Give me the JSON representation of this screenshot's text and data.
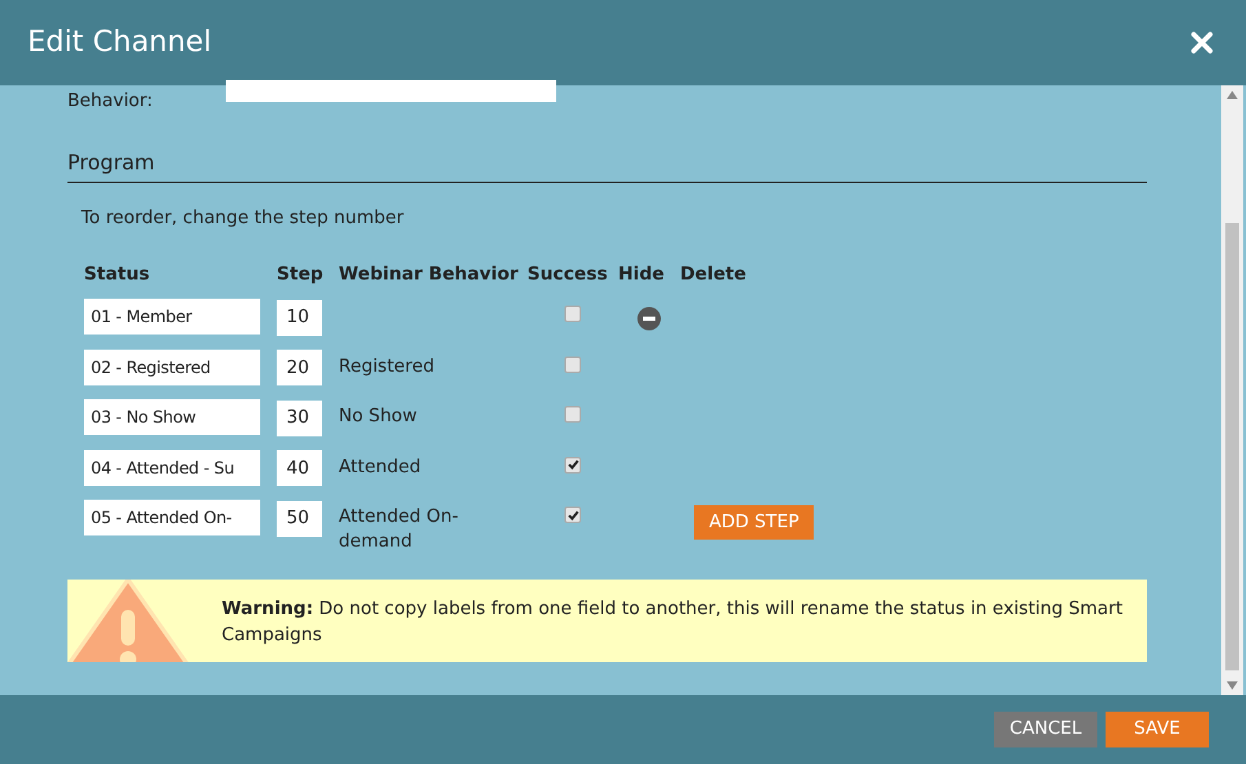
{
  "window": {
    "title": "Edit Channel"
  },
  "behavior_field": {
    "label": "Behavior:"
  },
  "section": {
    "title": "Program",
    "hint": "To reorder, change the step number"
  },
  "table": {
    "columns": [
      "Status",
      "Step",
      "Webinar Behavior",
      "Success",
      "Hide",
      "Delete"
    ],
    "rows": [
      {
        "status": "01 - Member",
        "step": "10",
        "webinar_behavior": "",
        "success": false,
        "hide_button": true
      },
      {
        "status": "02 - Registered",
        "step": "20",
        "webinar_behavior": "Registered",
        "success": false,
        "hide_button": false
      },
      {
        "status": "03 - No Show",
        "step": "30",
        "webinar_behavior": "No Show",
        "success": false,
        "hide_button": false
      },
      {
        "status": "04 - Attended - Su",
        "step": "40",
        "webinar_behavior": "Attended",
        "success": true,
        "hide_button": false
      },
      {
        "status": "05 - Attended On-",
        "step": "50",
        "webinar_behavior": "Attended On-demand",
        "success": true,
        "hide_button": false
      }
    ]
  },
  "add_step_button": "ADD STEP",
  "warning": {
    "text": "**Warning:** Do not copy labels from one field to another, this will rename the status in existing Smart Campaigns"
  },
  "buttons": [
    "CANCEL",
    "SAVE"
  ]
}
